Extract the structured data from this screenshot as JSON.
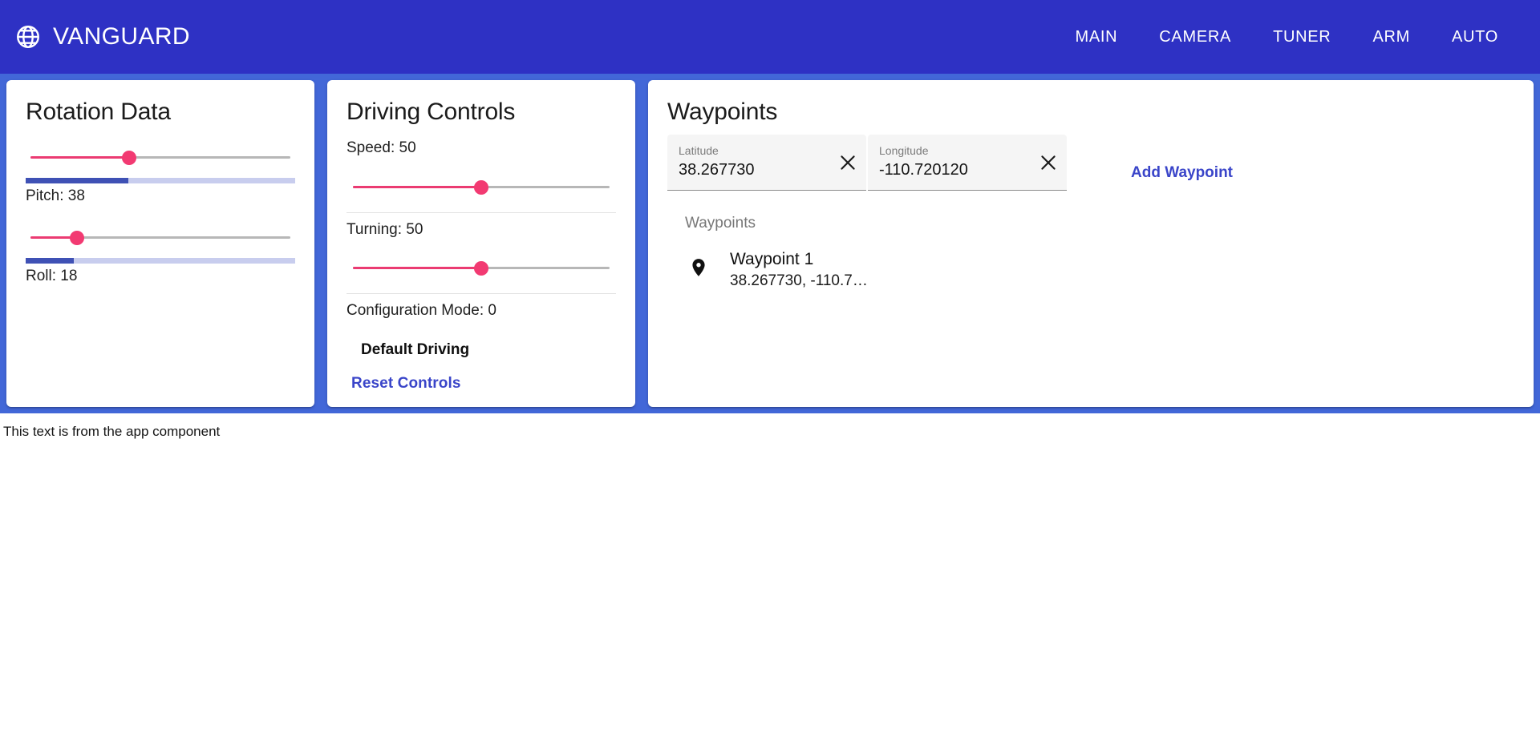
{
  "app": {
    "brand": "VANGUARD",
    "brand_icon": "globe-icon",
    "header_bg": "#2e31c4",
    "body_bg": "#4267d8",
    "accent_pink": "#f23a72",
    "accent_indigo": "#3f51b5",
    "link_color": "#3a45c9"
  },
  "nav": {
    "items": [
      {
        "label": "MAIN"
      },
      {
        "label": "CAMERA"
      },
      {
        "label": "TUNER"
      },
      {
        "label": "ARM"
      },
      {
        "label": "AUTO"
      }
    ]
  },
  "rotation": {
    "title": "Rotation Data",
    "pitch": {
      "label": "Pitch: 38",
      "value": 38,
      "slider_percent": 38,
      "progress_percent": 38
    },
    "roll": {
      "label": "Roll: 18",
      "value": 18,
      "slider_percent": 18,
      "progress_percent": 18
    }
  },
  "driving": {
    "title": "Driving Controls",
    "speed": {
      "label": "Speed: 50",
      "value": 50,
      "slider_percent": 50
    },
    "turning": {
      "label": "Turning: 50",
      "value": 50,
      "slider_percent": 50
    },
    "config_mode": {
      "label": "Configuration Mode: 0",
      "value": 0
    },
    "mode_name": "Default Driving",
    "reset_label": "Reset Controls"
  },
  "waypoints": {
    "title": "Waypoints",
    "latitude_field": {
      "label": "Latitude",
      "value": "38.267730",
      "placeholder": "Latitude",
      "clear_icon": "close-icon"
    },
    "longitude_field": {
      "label": "Longitude",
      "value": "-110.720120",
      "placeholder": "Longitude",
      "clear_icon": "close-icon"
    },
    "add_label": "Add Waypoint",
    "list_header": "Waypoints",
    "items": [
      {
        "icon": "map-pin-icon",
        "name": "Waypoint 1",
        "coords": "38.267730, -110.7…"
      }
    ]
  },
  "footer": {
    "text": "This text is from the app component"
  }
}
